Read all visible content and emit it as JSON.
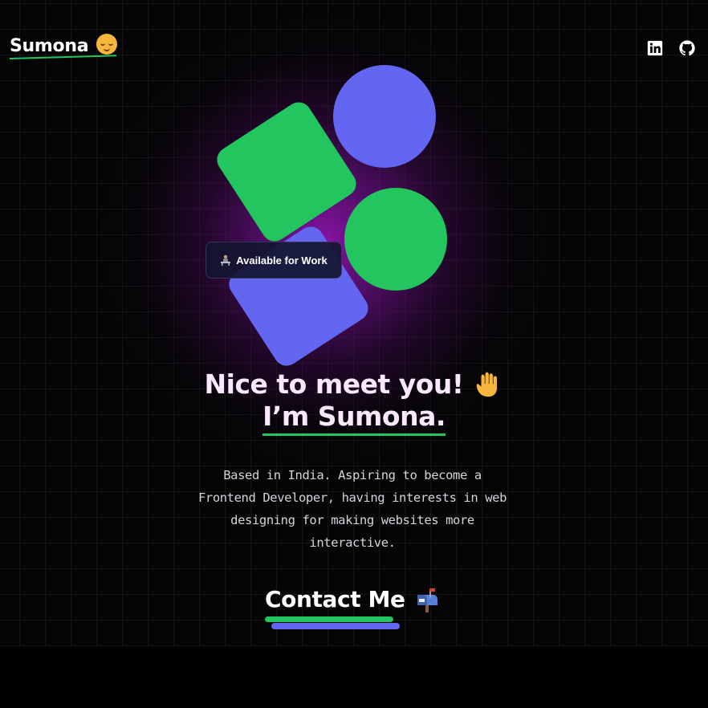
{
  "header": {
    "logo_text": "Sumona",
    "logo_emoji_icon": "relieved-face-icon",
    "social": [
      {
        "name": "LinkedIn",
        "icon": "linkedin-icon"
      },
      {
        "name": "GitHub",
        "icon": "github-icon"
      }
    ]
  },
  "hero": {
    "badge_text": "Available for Work",
    "badge_icon": "person-at-desk-icon",
    "headline_line1": "Nice to meet you!",
    "headline_icon": "waving-hand-icon",
    "headline_line2": "I’m Sumona.",
    "bio": "Based in India. Aspiring to become a Frontend Developer, having interests in web designing for making websites more interactive.",
    "contact_label": "Contact Me",
    "contact_icon": "mailbox-icon"
  },
  "colors": {
    "accent_green": "#22c55e",
    "accent_purple": "#6366f1",
    "glow": "#8c14aa",
    "background": "#000000"
  }
}
